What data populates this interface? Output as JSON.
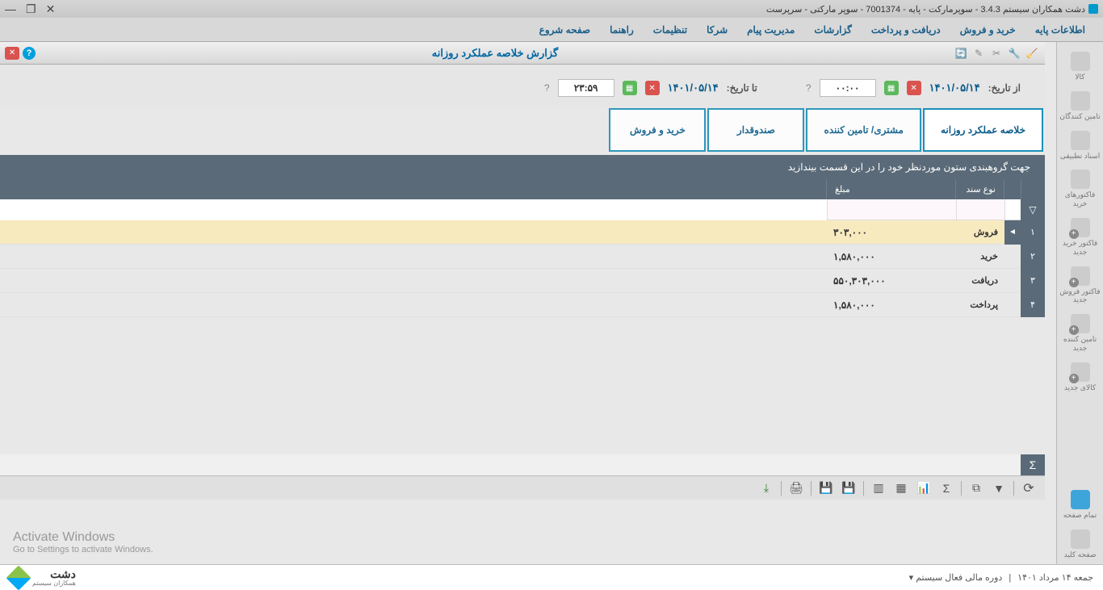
{
  "title": "دشت همکاران سیستم 3.4.3 - سوپرمارکت - پایه - 7001374 - سوپر مارکتی - سرپرست",
  "menu": {
    "items": [
      "اطلاعات پایه",
      "خرید و فروش",
      "دریافت و پرداخت",
      "گزارشات",
      "مدیریت پیام",
      "شرکا",
      "تنظیمات",
      "راهنما",
      "صفحه شروع"
    ]
  },
  "tab_title": "گزارش خلاصه عملکرد روزانه",
  "filter": {
    "from_label": "از تاریخ:",
    "to_label": "تا تاریخ:",
    "from_date": "۱۴۰۱/۰۵/۱۴",
    "to_date": "۱۴۰۱/۰۵/۱۴",
    "from_time": "۰۰:۰۰",
    "to_time": "۲۳:۵۹"
  },
  "tabs": [
    "خلاصه عملکرد روزانه",
    "مشتری/ تامین کننده",
    "صندوقدار",
    "خرید و فروش"
  ],
  "grouping_hint": "جهت گروهبندی ستون موردنظر خود را در این قسمت بیندازید",
  "table": {
    "header_type": "نوع سند",
    "header_amount": "مبلغ",
    "rows": [
      {
        "num": "۱",
        "type": "فروش",
        "amount": "۳۰۳,۰۰۰",
        "active": true
      },
      {
        "num": "۲",
        "type": "خرید",
        "amount": "۱,۵۸۰,۰۰۰",
        "active": false
      },
      {
        "num": "۳",
        "type": "دریافت",
        "amount": "۵۵۰,۳۰۳,۰۰۰",
        "active": false
      },
      {
        "num": "۴",
        "type": "پرداخت",
        "amount": "۱,۵۸۰,۰۰۰",
        "active": false
      }
    ]
  },
  "sidebar": {
    "items": [
      {
        "label": "کالا"
      },
      {
        "label": "تامین کنندگان"
      },
      {
        "label": "اسناد تطبیقی"
      },
      {
        "label": "فاکتورهای خرید"
      },
      {
        "label": "فاکتور خرید جدید"
      },
      {
        "label": "فاکتور فروش جدید"
      },
      {
        "label": "تامین کننده جدید"
      },
      {
        "label": "کالای جدید"
      }
    ],
    "bottom": [
      {
        "label": "تمام صفحه"
      },
      {
        "label": "صفحه کلید"
      }
    ]
  },
  "status": {
    "date": "جمعه ۱۴ مرداد ۱۴۰۱",
    "fiscal": "دوره مالی فعال سیستم",
    "logo_main": "دشت",
    "logo_sub": "همکاران سیستم"
  },
  "watermark": {
    "line1": "Activate Windows",
    "line2": "Go to Settings to activate Windows."
  }
}
